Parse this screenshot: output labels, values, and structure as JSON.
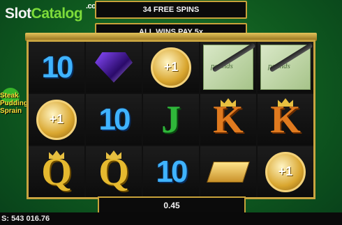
{
  "watermark": {
    "part1": "Slot",
    "part2": "Catalog",
    "suffix": ".com"
  },
  "header": {
    "free_spins": "34 FREE SPINS",
    "multiplier": "ALL WINS PAY 5x"
  },
  "side_logo": {
    "line1": "Steak",
    "line2": "Pudding",
    "line3": "Sprain"
  },
  "reels": [
    [
      {
        "type": "10",
        "label": "10"
      },
      {
        "type": "coin",
        "label": "+1"
      },
      {
        "type": "Q",
        "label": "Q"
      }
    ],
    [
      {
        "type": "gem",
        "label": ""
      },
      {
        "type": "10",
        "label": "10"
      },
      {
        "type": "Q",
        "label": "Q"
      }
    ],
    [
      {
        "type": "coin",
        "label": "+1"
      },
      {
        "type": "J",
        "label": "J"
      },
      {
        "type": "10",
        "label": "10"
      }
    ],
    [
      {
        "type": "cash",
        "label": "pounds"
      },
      {
        "type": "K",
        "label": "K"
      },
      {
        "type": "gold",
        "label": ""
      }
    ],
    [
      {
        "type": "cash",
        "label": "pounds"
      },
      {
        "type": "K",
        "label": "K"
      },
      {
        "type": "coin",
        "label": "+1"
      }
    ]
  ],
  "win": {
    "amount": "0.45"
  },
  "balance": {
    "label": "S:",
    "value": "543 016.76"
  }
}
